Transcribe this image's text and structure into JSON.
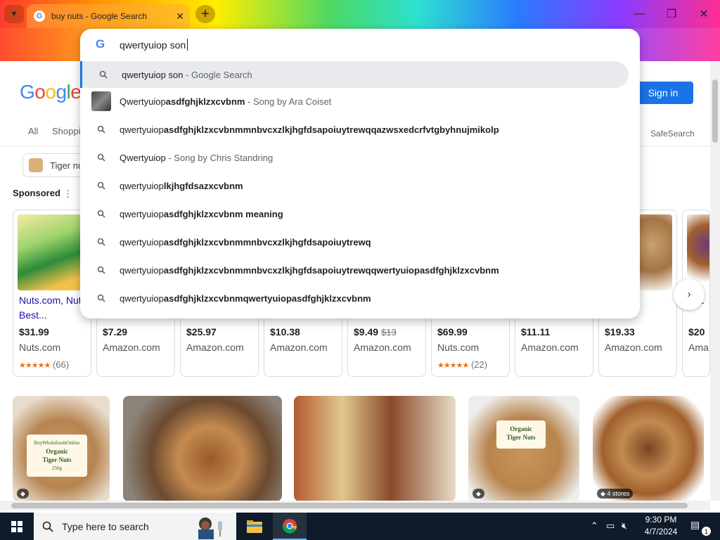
{
  "browser": {
    "tab_title": "buy nuts - Google Search",
    "close_glyph": "✕",
    "new_tab_glyph": "+"
  },
  "omnibox": {
    "value": "qwertyuiop son",
    "suggestions": [
      {
        "prefix": "qwertyuiop son",
        "bold": "",
        "sub": " - Google Search",
        "icon": "search-icon"
      },
      {
        "prefix": "Qwertyuiop",
        "bold": "asdfghjklzxcvbnm",
        "sub": " - Song by Ara Coiset",
        "icon": "song-thumbnail"
      },
      {
        "prefix": "qwertyuiop",
        "bold": "asdfghjklzxcvbnmmnbvcxzlkjhgfdsapoiuytrewqqazwsxedcrfvtgbyhnujmikolp",
        "sub": "",
        "icon": "search-icon"
      },
      {
        "prefix": "Qwertyuiop",
        "bold": "",
        "sub": " - Song by Chris Standring",
        "icon": "search-icon"
      },
      {
        "prefix": "qwertyuiop",
        "bold": "lkjhgfdsazxcvbnm",
        "sub": "",
        "icon": "search-icon"
      },
      {
        "prefix": "qwertyuiop",
        "bold": "asdfghjklzxcvbnm meaning",
        "sub": "",
        "icon": "search-icon"
      },
      {
        "prefix": "qwertyuiop",
        "bold": "asdfghjklzxcvbnmmnbvcxzlkjhgfdsapoiuytrewq",
        "sub": "",
        "icon": "search-icon"
      },
      {
        "prefix": "qwertyuiop",
        "bold": "asdfghjklzxcvbnmmnbvcxzlkjhgfdsapoiuytrewqqwertyuiopasdfghjklzxcvbnm",
        "sub": "",
        "icon": "search-icon"
      },
      {
        "prefix": "qwertyuiop",
        "bold": "asdfghjklzxcvbnmqwertyuiopasdfghjklzxcvbnm",
        "sub": "",
        "icon": "search-icon"
      }
    ]
  },
  "page": {
    "logo": "Google",
    "signin_label": "Sign in",
    "tabs": [
      "All",
      "Shoppi"
    ],
    "safesearch_label": "SafeSearch",
    "chip_label": "Tiger nu",
    "sponsored_label": "Sponsored",
    "products": [
      {
        "title": "Nuts.com, Nutty Best...",
        "price": "$31.99",
        "was": "",
        "store": "Nuts.com",
        "rating": "(66)"
      },
      {
        "title": "",
        "price": "$7.29",
        "was": "",
        "store": "Amazon.com",
        "rating": ""
      },
      {
        "title": "",
        "price": "$25.97",
        "was": "",
        "store": "Amazon.com",
        "rating": ""
      },
      {
        "title": "",
        "price": "$10.38",
        "was": "",
        "store": "Amazon.com",
        "rating": ""
      },
      {
        "title": "",
        "price": "$9.49",
        "was": "$13",
        "store": "Amazon.com",
        "rating": ""
      },
      {
        "title": "",
        "price": "$69.99",
        "was": "",
        "store": "Nuts.com",
        "rating": "(22)"
      },
      {
        "title": "",
        "price": "$11.11",
        "was": "",
        "store": "Amazon.com",
        "rating": ""
      },
      {
        "title": "...ts...",
        "price": "$19.33",
        "was": "",
        "store": "Amazon.com",
        "rating": ""
      },
      {
        "title": "Nut",
        "price": "$20",
        "was": "",
        "store": "Ama",
        "rating": ""
      }
    ],
    "image_results": [
      {
        "label_lines": [
          "BuyWholefoodsOnline",
          "Organic",
          "Tiger Nuts",
          "250g"
        ],
        "badge": ""
      },
      {
        "label_lines": [],
        "badge": ""
      },
      {
        "label_lines": [],
        "badge": ""
      },
      {
        "label_lines": [
          "Organic",
          "Tiger Nuts"
        ],
        "badge": ""
      },
      {
        "label_lines": [],
        "badge": "4 stores"
      }
    ]
  },
  "taskbar": {
    "search_placeholder": "Type here to search",
    "time": "9:30 PM",
    "date": "4/7/2024",
    "notification_count": "1"
  },
  "colors": {
    "accent": "#1a73e8",
    "link": "#1a0dab",
    "star": "#e7711b",
    "avatar": "#f7a823"
  }
}
